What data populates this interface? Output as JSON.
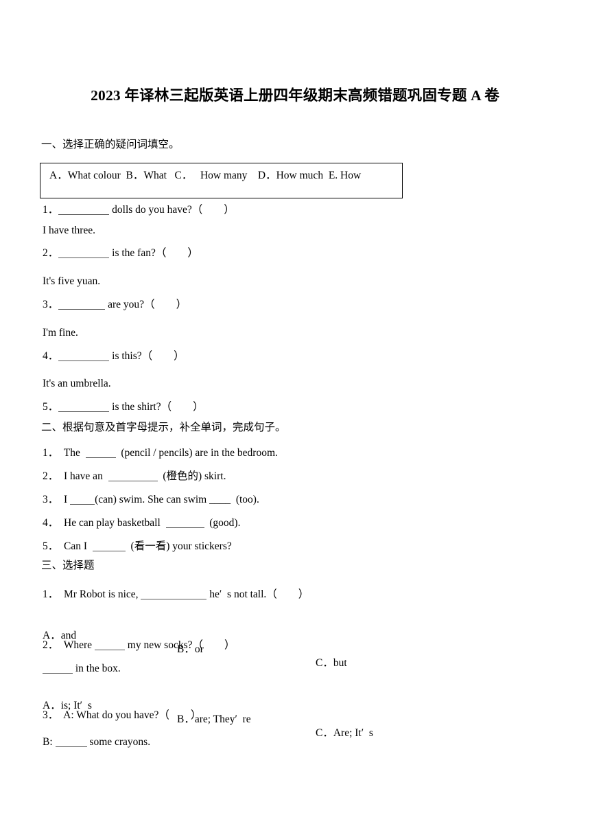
{
  "document": {
    "title": "2023 年译林三起版英语上册四年级期末高频错题巩固专题 A 卷"
  },
  "section_one": {
    "heading": "一、选择正确的疑问词填空。",
    "wordbank": "A．What colour  B．What   C．   How many    D．How much  E. How",
    "items": [
      {
        "number": "1．",
        "before": "",
        "after": " dolls do you have?（        ）",
        "answer_line": "I have three."
      },
      {
        "number": "2．",
        "before": "",
        "after": " is the fan?（        ）",
        "answer_line": "It's five yuan."
      },
      {
        "number": "3．",
        "before": "",
        "after": " are you?（        ）",
        "answer_line": "I'm fine."
      },
      {
        "number": "4．",
        "before": "",
        "after": " is this?（        ）",
        "answer_line": "It's an umbrella."
      },
      {
        "number": "5．",
        "before": "",
        "after": " is the shirt?（        ）",
        "answer_line": ""
      }
    ]
  },
  "section_two": {
    "heading": "二、根据句意及首字母提示，补全单词，完成句子。",
    "items": [
      {
        "number": "1．",
        "pre": "  The  ",
        "post": "  (pencil / pencils) are in the bedroom."
      },
      {
        "number": "2．",
        "pre": "  I have an  ",
        "post": "  (橙色的) skirt."
      },
      {
        "number": "3．",
        "pre": "  I ",
        "post": "(can) swim. She can swim ____  (too)."
      },
      {
        "number": "4．",
        "pre": "  He can play basketball  ",
        "post": "  (good)."
      },
      {
        "number": "5．",
        "pre": "  Can I  ",
        "post": "  (看一看) your stickers?"
      }
    ]
  },
  "section_three": {
    "heading": "三、选择题",
    "q1": {
      "number": "1．",
      "stem_pre": "  Mr Robot is nice, ",
      "stem_post": " he′  s not tall.（        ）",
      "options": [
        "A．and",
        "B．or",
        "C．but"
      ]
    },
    "q2": {
      "number": "2．",
      "stem_pre": "  Where ",
      "stem_post": " my new socks?（        ）",
      "second_line_post": " in the box.",
      "options": [
        "A．is; It′  s",
        "B．are; They′  re",
        "C．Are; It′  s"
      ]
    },
    "q3": {
      "number": "3．",
      "stem": "  A: What do you have?（        ）",
      "answer_pre": "B: ",
      "answer_post": " some crayons."
    }
  }
}
